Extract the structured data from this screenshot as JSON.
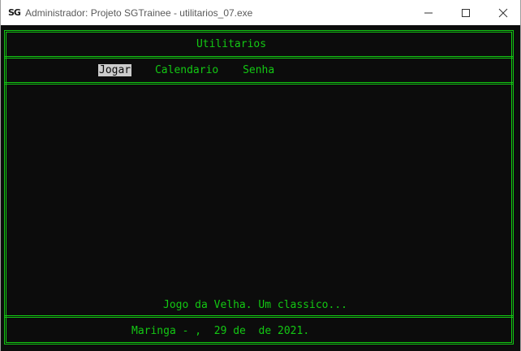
{
  "window": {
    "icon_text": "SG",
    "title": "Administrador: Projeto SGTrainee - utilitarios_07.exe"
  },
  "console": {
    "header_title": "Utilitarios",
    "menu": [
      {
        "label": "Jogar",
        "selected": true
      },
      {
        "label": "Calendario",
        "selected": false
      },
      {
        "label": "Senha",
        "selected": false
      }
    ],
    "status": "Jogo da Velha. Um classico...",
    "footer": "Maringa - ,  29 de  de 2021."
  },
  "colors": {
    "console_bg": "#0c0c0c",
    "console_fg": "#13c813",
    "selection_bg": "#cccccc"
  }
}
